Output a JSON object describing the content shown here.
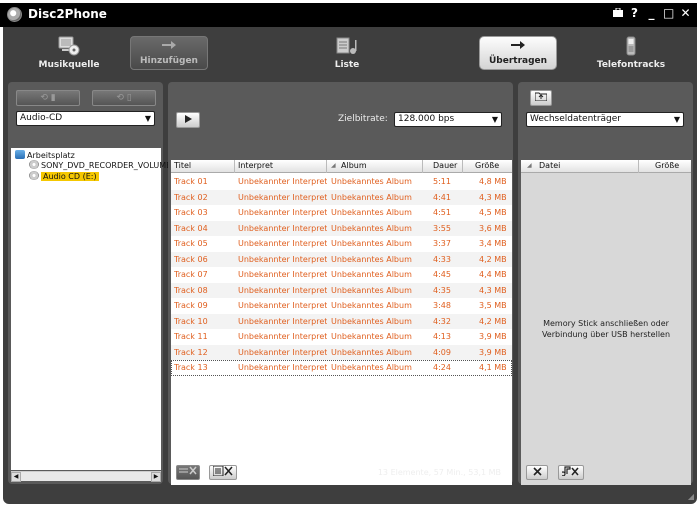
{
  "window": {
    "title": "Disc2Phone",
    "controls": [
      "briefcase-icon",
      "?",
      "_",
      "□",
      "✕"
    ]
  },
  "nav": {
    "items": [
      {
        "label": "Musikquelle",
        "icon": "computer-cd-icon"
      },
      {
        "label": "Hinzufügen",
        "icon": "arrow-right-icon"
      },
      {
        "label": "Liste",
        "icon": "playlist-icon"
      },
      {
        "label": "Übertragen",
        "icon": "arrow-right-icon"
      },
      {
        "label": "Telefontracks",
        "icon": "phone-icon"
      }
    ]
  },
  "left": {
    "source_select": "Audio-CD",
    "tree": {
      "root": "Arbeitsplatz",
      "items": [
        "SONY_DVD_RECORDER_VOLUME",
        "Audio CD (E:)"
      ]
    }
  },
  "middle": {
    "bitrate_label": "Zielbitrate:",
    "bitrate_value": "128.000 bps",
    "columns": [
      "Titel",
      "Interpret",
      "Album",
      "Dauer",
      "Größe"
    ],
    "tracks": [
      {
        "title": "Track 01",
        "artist": "Unbekannter Interpret",
        "album": "Unbekanntes Album",
        "duration": "5:11",
        "size": "4,8 MB"
      },
      {
        "title": "Track 02",
        "artist": "Unbekannter Interpret",
        "album": "Unbekanntes Album",
        "duration": "4:41",
        "size": "4,3 MB"
      },
      {
        "title": "Track 03",
        "artist": "Unbekannter Interpret",
        "album": "Unbekanntes Album",
        "duration": "4:51",
        "size": "4,5 MB"
      },
      {
        "title": "Track 04",
        "artist": "Unbekannter Interpret",
        "album": "Unbekanntes Album",
        "duration": "3:55",
        "size": "3,6 MB"
      },
      {
        "title": "Track 05",
        "artist": "Unbekannter Interpret",
        "album": "Unbekanntes Album",
        "duration": "3:37",
        "size": "3,4 MB"
      },
      {
        "title": "Track 06",
        "artist": "Unbekannter Interpret",
        "album": "Unbekanntes Album",
        "duration": "4:33",
        "size": "4,2 MB"
      },
      {
        "title": "Track 07",
        "artist": "Unbekannter Interpret",
        "album": "Unbekanntes Album",
        "duration": "4:45",
        "size": "4,4 MB"
      },
      {
        "title": "Track 08",
        "artist": "Unbekannter Interpret",
        "album": "Unbekanntes Album",
        "duration": "4:35",
        "size": "4,3 MB"
      },
      {
        "title": "Track 09",
        "artist": "Unbekannter Interpret",
        "album": "Unbekanntes Album",
        "duration": "3:48",
        "size": "3,5 MB"
      },
      {
        "title": "Track 10",
        "artist": "Unbekannter Interpret",
        "album": "Unbekanntes Album",
        "duration": "4:32",
        "size": "4,2 MB"
      },
      {
        "title": "Track 11",
        "artist": "Unbekannter Interpret",
        "album": "Unbekanntes Album",
        "duration": "4:13",
        "size": "3,9 MB"
      },
      {
        "title": "Track 12",
        "artist": "Unbekannter Interpret",
        "album": "Unbekanntes Album",
        "duration": "4:09",
        "size": "3,9 MB"
      },
      {
        "title": "Track 13",
        "artist": "Unbekannter Interpret",
        "album": "Unbekanntes Album",
        "duration": "4:24",
        "size": "4,1 MB"
      }
    ],
    "status": "13 Elemente, 57 Min., 53,1 MB"
  },
  "right": {
    "device_select": "Wechseldatenträger",
    "columns": [
      "Datei",
      "Größe"
    ],
    "message_line1": "Memory Stick anschließen oder",
    "message_line2": "Verbindung über USB herstellen"
  },
  "colors": {
    "frame": "#3e3e3e",
    "panel": "#5a5a5a",
    "track_text": "#e06020",
    "highlight": "#f5c800"
  }
}
